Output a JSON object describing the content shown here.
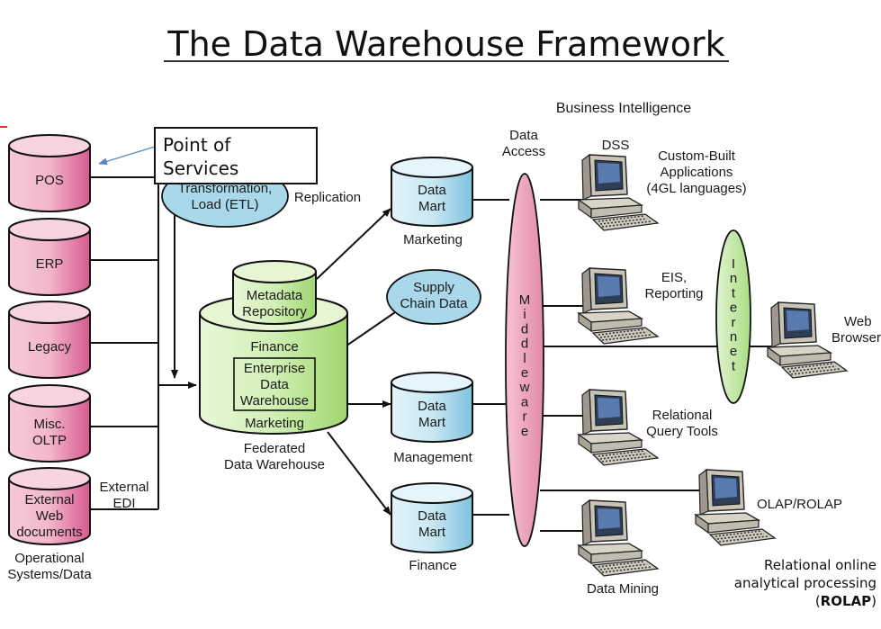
{
  "title": "The Data Warehouse Framework",
  "sources": {
    "pos": "POS",
    "erp": "ERP",
    "legacy": "Legacy",
    "misc_line1": "Misc.",
    "misc_line2": "OLTP",
    "ext_line1": "External",
    "ext_line2": "Web",
    "ext_line3": "documents",
    "caption_line1": "Operational",
    "caption_line2": "Systems/Data"
  },
  "callout": {
    "line1": "Point of",
    "line2": "Services"
  },
  "etl": {
    "line1": "Transformation,",
    "line2": "Load (ETL)"
  },
  "replication": "Replication",
  "external_edi": {
    "line1": "External",
    "line2": "EDI"
  },
  "metadata": {
    "line1": "Metadata",
    "line2": "Repository"
  },
  "warehouse": {
    "finance": "Finance",
    "inner_line1": "Enterprise",
    "inner_line2": "Data",
    "inner_line3": "Warehouse",
    "marketing": "Marketing",
    "caption_line1": "Federated",
    "caption_line2": "Data Warehouse"
  },
  "supply_chain": {
    "line1": "Supply",
    "line2": "Chain Data"
  },
  "marts": [
    {
      "line1": "Data",
      "line2": "Mart",
      "caption": "Marketing"
    },
    {
      "line1": "Data",
      "line2": "Mart",
      "caption": "Management"
    },
    {
      "line1": "Data",
      "line2": "Mart",
      "caption": "Finance"
    }
  ],
  "business_intelligence": "Business Intelligence",
  "data_access": {
    "line1": "Data",
    "line2": "Access"
  },
  "middleware": [
    "M",
    "i",
    "d",
    "d",
    "l",
    "e",
    "w",
    "a",
    "r",
    "e"
  ],
  "internet": [
    "I",
    "n",
    "t",
    "e",
    "r",
    "n",
    "e",
    "t"
  ],
  "tools": {
    "dss": "DSS",
    "custom_line1": "Custom-Built",
    "custom_line2": "Applications",
    "custom_line3": "(4GL languages)",
    "eis_line1": "EIS,",
    "eis_line2": "Reporting",
    "web_line1": "Web",
    "web_line2": "Browser",
    "rel_line1": "Relational",
    "rel_line2": "Query Tools",
    "olap": "OLAP/ROLAP",
    "mining": "Data Mining"
  },
  "rolap_note": {
    "line1": "Relational online",
    "line2": "analytical processing",
    "line3_open": "(",
    "line3_bold": "ROLAP",
    "line3_close": ")"
  },
  "colors": {
    "pink": "#e37aa6",
    "blue": "#9fd4e8",
    "green": "#b6e08c",
    "ellipse_pink": "#efa6c0",
    "ellipse_green": "#c2e8a0"
  }
}
